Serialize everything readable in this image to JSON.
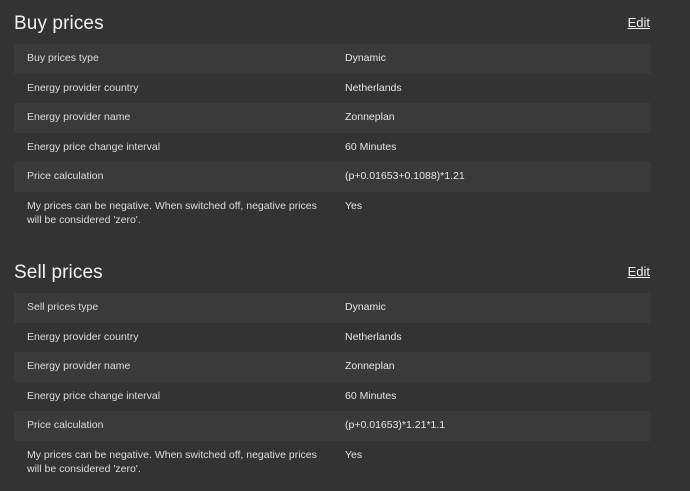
{
  "buy": {
    "title": "Buy prices",
    "edit_label": "Edit",
    "rows": [
      {
        "label": "Buy prices type",
        "value": "Dynamic"
      },
      {
        "label": "Energy provider country",
        "value": "Netherlands"
      },
      {
        "label": "Energy provider name",
        "value": "Zonneplan"
      },
      {
        "label": "Energy price change interval",
        "value": "60 Minutes"
      },
      {
        "label": "Price calculation",
        "value": "(p+0.01653+0.1088)*1.21"
      },
      {
        "label": "My prices can be negative. When switched off, negative prices will be considered 'zero'.",
        "value": "Yes"
      }
    ]
  },
  "sell": {
    "title": "Sell prices",
    "edit_label": "Edit",
    "rows": [
      {
        "label": "Sell prices type",
        "value": "Dynamic"
      },
      {
        "label": "Energy provider country",
        "value": "Netherlands"
      },
      {
        "label": "Energy provider name",
        "value": "Zonneplan"
      },
      {
        "label": "Energy price change interval",
        "value": "60 Minutes"
      },
      {
        "label": "Price calculation",
        "value": "(p+0.01653)*1.21*1.1"
      },
      {
        "label": "My prices can be negative. When switched off, negative prices will be considered 'zero'.",
        "value": "Yes"
      }
    ]
  }
}
